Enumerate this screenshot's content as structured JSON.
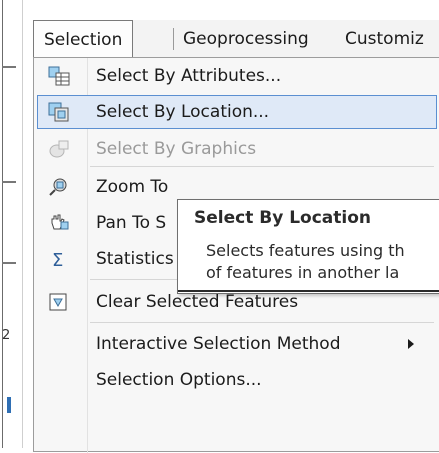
{
  "menubar": {
    "items": [
      {
        "label": "Selection"
      },
      {
        "label": "Geoprocessing"
      },
      {
        "label": "Customiz"
      }
    ]
  },
  "menu": {
    "items": [
      {
        "label": "Select By Attributes...",
        "icon": "table-select-icon",
        "state": "normal"
      },
      {
        "label": "Select By Location...",
        "icon": "location-select-icon",
        "state": "highlighted"
      },
      {
        "label": "Select By Graphics",
        "icon": "graphics-select-icon",
        "state": "disabled"
      },
      {
        "label": "Zoom To Selected Features",
        "icon": "zoom-to-selected-icon",
        "state": "normal"
      },
      {
        "label": "Pan To Selected Features",
        "icon": "pan-to-selected-icon",
        "state": "normal"
      },
      {
        "label": "Statistics...",
        "icon": "sigma-icon",
        "state": "normal"
      },
      {
        "label": "Clear Selected Features",
        "icon": "clear-selection-icon",
        "state": "normal"
      },
      {
        "label": "Interactive Selection Method",
        "icon": "",
        "state": "normal",
        "submenu": true
      },
      {
        "label": "Selection Options...",
        "icon": "",
        "state": "normal"
      }
    ],
    "visible_labels": {
      "zoom": "Zoom To",
      "pan": "Pan To S",
      "stats": "Statistics"
    }
  },
  "tooltip": {
    "title": "Select By Location",
    "line1": "Selects features using th",
    "line2": "of features in another la"
  },
  "background": {
    "digit": "2"
  },
  "colors": {
    "highlight_fill": "#dfe9f7",
    "highlight_border": "#5b8fd1",
    "accent_blue": "#2f6fb4"
  }
}
